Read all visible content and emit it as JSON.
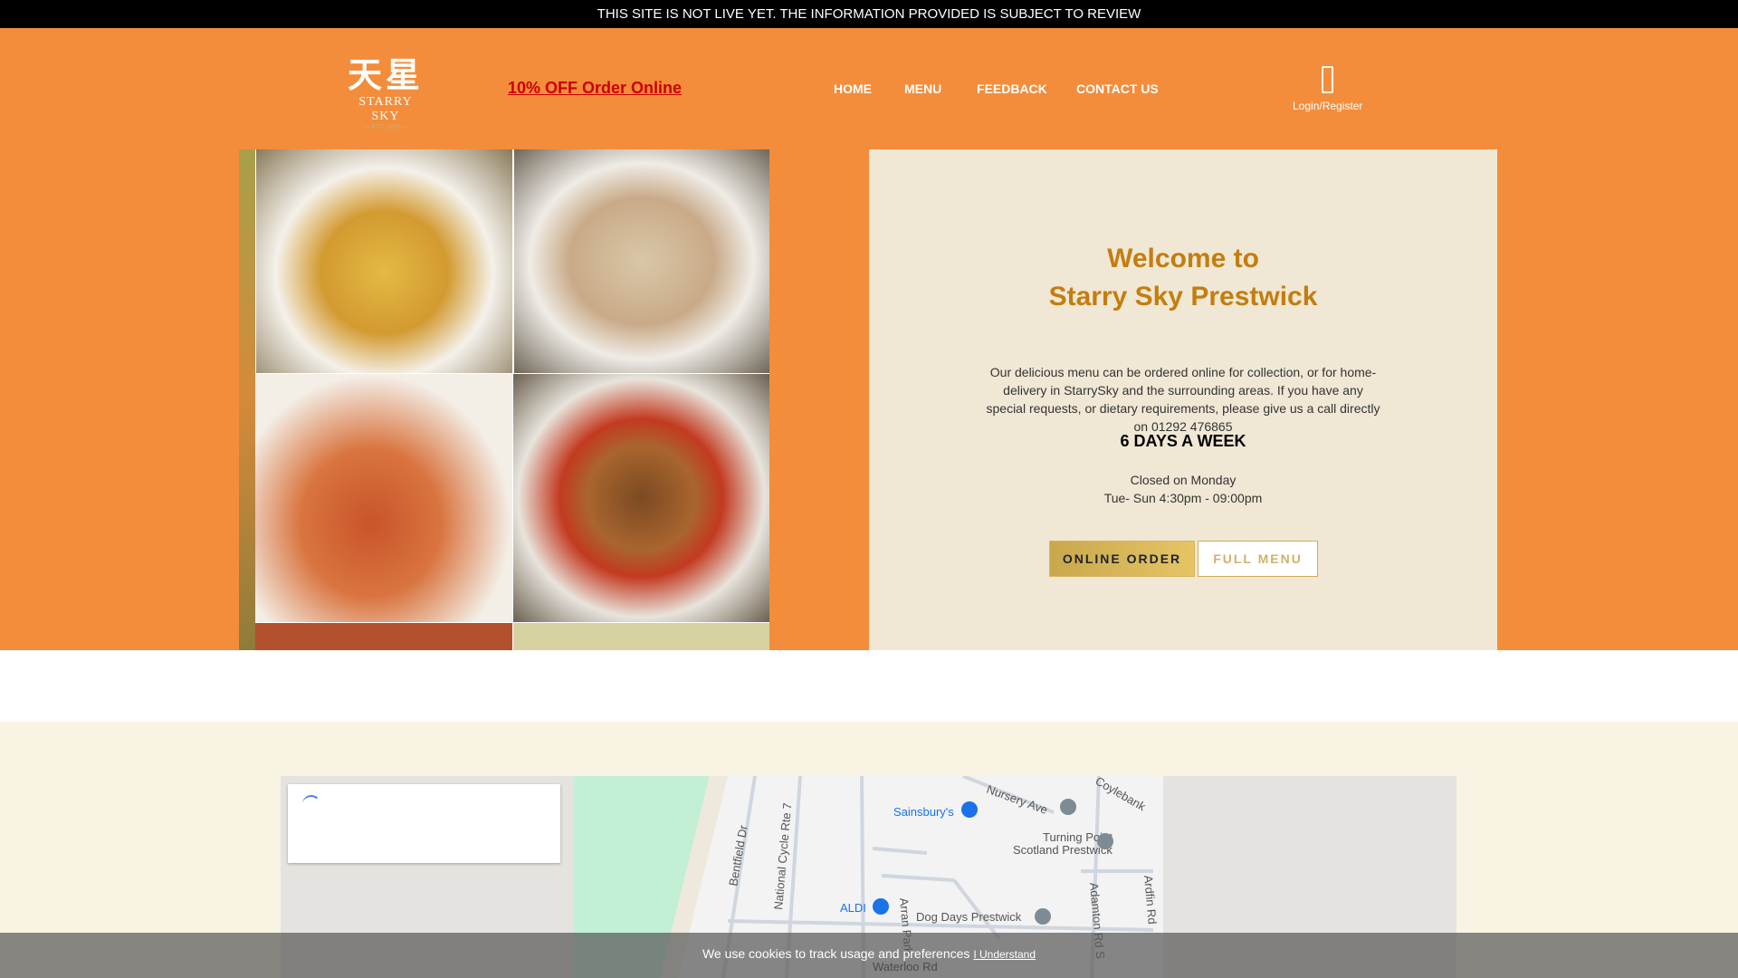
{
  "banner": "THIS SITE IS NOT LIVE YET. THE INFORMATION PROVIDED IS SUBJECT TO REVIEW",
  "logo": {
    "chinese": "天星",
    "english": "STARRY SKY",
    "sub": "— EST 1998 —"
  },
  "promo": "10% OFF Order Online",
  "nav": [
    "HOME",
    "MENU",
    "FEEDBACK",
    "CONTACT US"
  ],
  "login": "Login/Register",
  "welcome": {
    "line1": "Welcome to",
    "line2": "Starry Sky Prestwick",
    "description": "Our delicious menu can be ordered online for collection, or for home-delivery in StarrySky and the surrounding areas. If you have any special requests, or dietary requirements, please give us a call directly on 01292 476865",
    "days": "6 DAYS A WEEK",
    "closed": "Closed on Monday",
    "hours": "Tue- Sun 4:30pm - 09:00pm",
    "online_order": "ONLINE ORDER",
    "full_menu": "FULL MENU"
  },
  "map": {
    "labels": [
      "Nursery Ave",
      "Coylebank",
      "Sainsbury's",
      "Turning Point",
      "Scotland Prestwick",
      "Bentfield Dr",
      "National Cycle Rte 7",
      "ALDI",
      "Dog Days Prestwick",
      "Adamton Rd S",
      "Ardfin Rd",
      "Arran Park",
      "Waterloo Rd"
    ]
  },
  "cookie": {
    "text": "We use cookies to track usage and preferences",
    "accept": "I Understand"
  }
}
